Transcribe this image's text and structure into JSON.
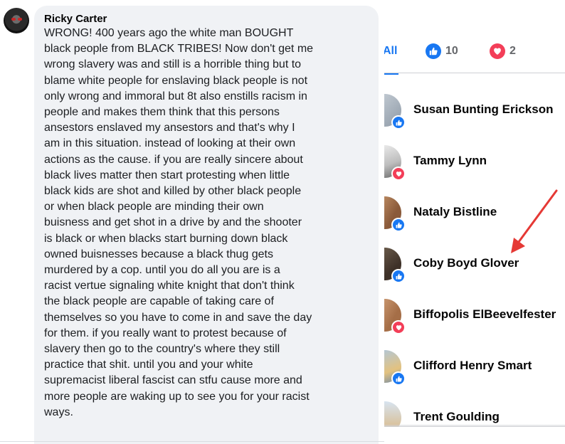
{
  "comment": {
    "author": "Ricky Carter",
    "lines": [
      "WRONG! 400 years ago the white man BOUGHT",
      "black people from BLACK TRIBES! Now don't get me",
      "wrong slavery was and still is a horrible thing but to",
      "blame white people for enslaving black people is not",
      "only wrong and immoral but 8t also enstills racism in",
      "people and makes them think that this persons",
      "ansestors enslaved my ansestors and that's why I",
      "am in this situation. instead of looking at their own",
      "actions as the cause. if you are really sincere about",
      "black lives matter then start protesting when little",
      "black kids are shot and killed by other black people",
      "or when black people are minding their own",
      "buisness and get shot in a drive by and the shooter",
      "is black or when blacks start burning down black",
      "owned buisnesses because a black thug gets",
      "murdered by a cop. until you do all you are is a",
      "racist vertue signaling white knight that don't think",
      "the black people are capable of taking care of",
      "themselves so you have to come in and save the day",
      "for them. if you really want to protest because of",
      "slavery then go to the country's where they still",
      "practice that shit. until you and your white",
      "supremacist liberal fascist can stfu cause more and",
      "more people are waking up to see you for your racist",
      "ways."
    ]
  },
  "reactions": {
    "tabs": {
      "all_label": "All",
      "like_count": "10",
      "love_count": "2"
    },
    "people": [
      {
        "name": "Susan Bunting Erickson",
        "reaction": "like"
      },
      {
        "name": "Tammy Lynn",
        "reaction": "love"
      },
      {
        "name": "Nataly Bistline",
        "reaction": "like"
      },
      {
        "name": "Coby Boyd Glover",
        "reaction": "like"
      },
      {
        "name": "Biffopolis ElBeevelfester",
        "reaction": "love"
      },
      {
        "name": "Clifford Henry Smart",
        "reaction": "like"
      },
      {
        "name": "Trent Goulding",
        "reaction": "like"
      }
    ]
  },
  "colors": {
    "brand_blue": "#1877f2",
    "love_red": "#f33e58",
    "arrow_red": "#e53935",
    "bubble_bg": "#f0f2f5"
  }
}
